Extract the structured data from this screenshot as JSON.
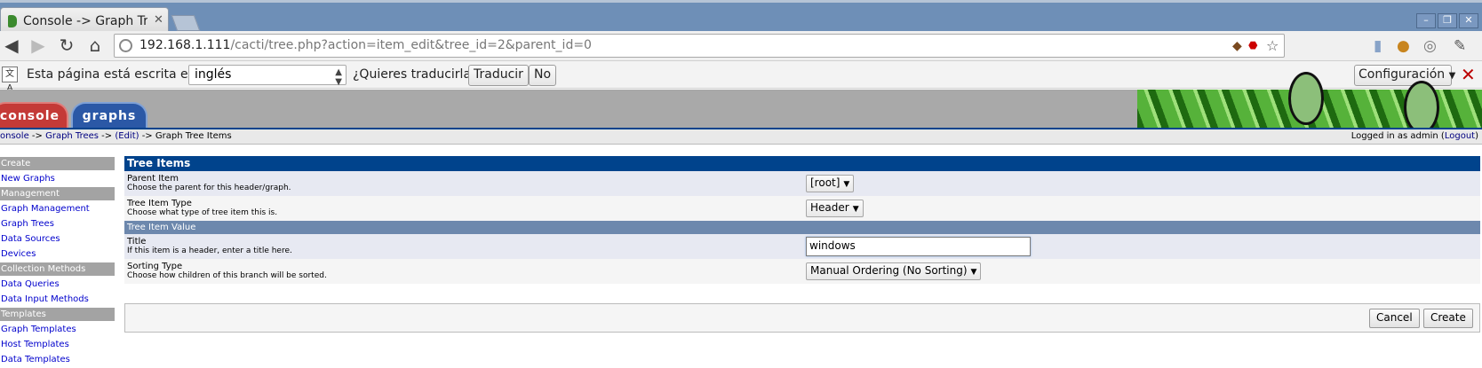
{
  "browser": {
    "tab_title": "Console -> Graph Trees",
    "tab_close": "✕",
    "url_host": "192.168.1.111",
    "url_path": "/cacti/tree.php?action=item_edit&tree_id=2&parent_id=0",
    "window_controls": [
      "–",
      "❐",
      "✕"
    ],
    "nav_icons": [
      "back-icon",
      "forward-icon",
      "reload-icon",
      "home-icon"
    ]
  },
  "translate_bar": {
    "message": "Esta página está escrita en",
    "language": "inglés",
    "question": "¿Quieres traducirla?",
    "translate_button": "Traducir",
    "no_button": "No",
    "config_button": "Configuración",
    "close": "✕"
  },
  "cacti": {
    "tabs": {
      "console": "console",
      "graphs": "graphs"
    },
    "breadcrumb": {
      "c1": "onsole",
      "sep1": " -> ",
      "c2": "Graph Trees",
      "sep2": " -> ",
      "c3": "(Edit)",
      "sep3": " -> ",
      "c4": "Graph Tree Items"
    },
    "login": {
      "prefix": "Logged in as admin (",
      "logout": "Logout",
      "suffix": ")"
    }
  },
  "menu": [
    {
      "type": "head",
      "label": "Create"
    },
    {
      "type": "item",
      "label": "New Graphs"
    },
    {
      "type": "head",
      "label": "Management"
    },
    {
      "type": "item",
      "label": "Graph Management"
    },
    {
      "type": "item",
      "label": "Graph Trees"
    },
    {
      "type": "item",
      "label": "Data Sources"
    },
    {
      "type": "item",
      "label": "Devices"
    },
    {
      "type": "head",
      "label": "Collection Methods"
    },
    {
      "type": "item",
      "label": "Data Queries"
    },
    {
      "type": "item",
      "label": "Data Input Methods"
    },
    {
      "type": "head",
      "label": "Templates"
    },
    {
      "type": "item",
      "label": "Graph Templates"
    },
    {
      "type": "item",
      "label": "Host Templates"
    },
    {
      "type": "item",
      "label": "Data Templates"
    }
  ],
  "form": {
    "header": "Tree Items",
    "parent": {
      "title": "Parent Item",
      "desc": "Choose the parent for this header/graph.",
      "value": "[root]"
    },
    "type": {
      "title": "Tree Item Type",
      "desc": "Choose what type of tree item this is.",
      "value": "Header"
    },
    "value_header": "Tree Item Value",
    "title_field": {
      "title": "Title",
      "desc": "If this item is a header, enter a title here.",
      "value": "windows"
    },
    "sorting": {
      "title": "Sorting Type",
      "desc": "Choose how children of this branch will be sorted.",
      "value": "Manual Ordering (No Sorting)"
    },
    "cancel": "Cancel",
    "create": "Create"
  }
}
